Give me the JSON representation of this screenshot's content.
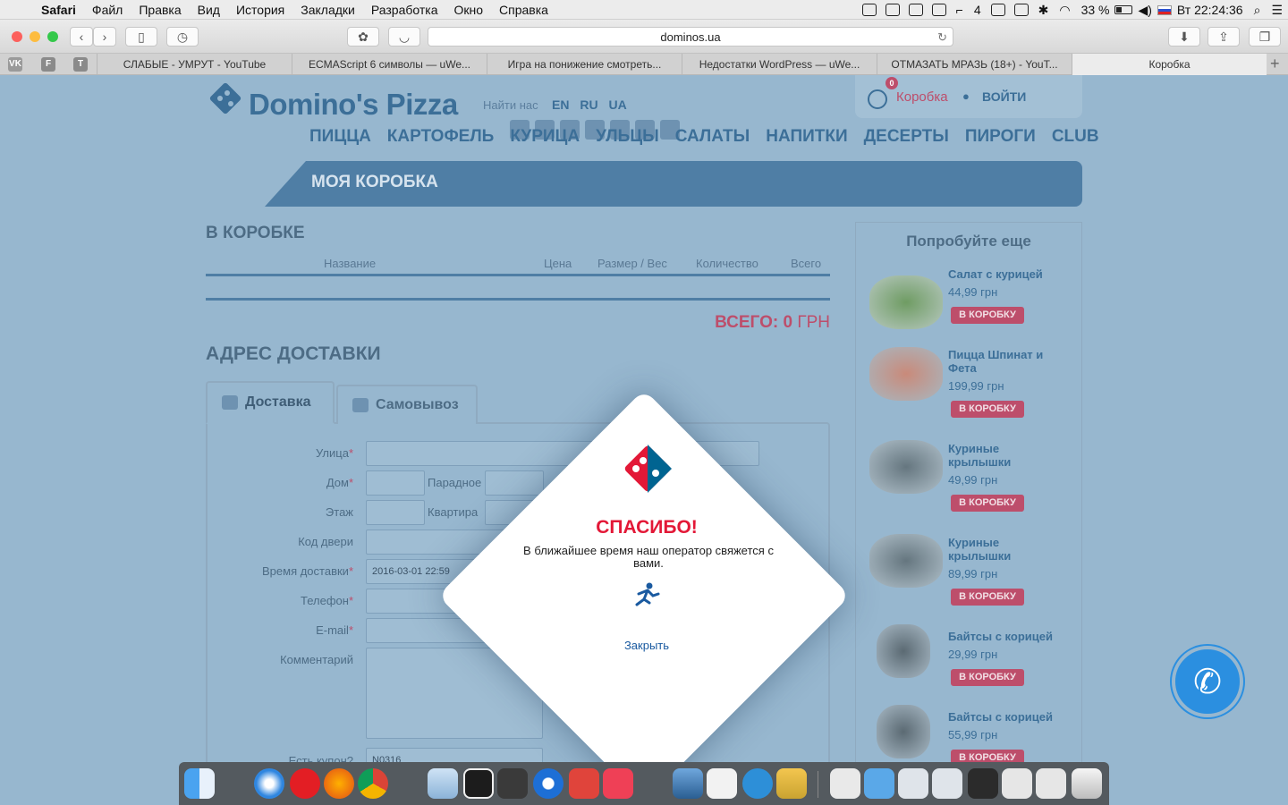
{
  "menubar": {
    "app": "Safari",
    "items": [
      "Файл",
      "Правка",
      "Вид",
      "История",
      "Закладки",
      "Разработка",
      "Окно",
      "Справка"
    ],
    "status_num": "4",
    "battery": "33 %",
    "clock": "Вт 22:24:36"
  },
  "browser": {
    "url": "dominos.ua",
    "pinned": [
      "VK",
      "F",
      "T"
    ],
    "tabs": [
      {
        "title": "СЛАБЫЕ - УМРУТ - YouTube"
      },
      {
        "title": "ECMAScript 6 символы — uWe..."
      },
      {
        "title": "Игра на понижение смотреть..."
      },
      {
        "title": "Недостатки WordPress — uWe..."
      },
      {
        "title": "ОТМАЗАТЬ МРАЗЬ (18+) - YouT..."
      },
      {
        "title": "Коробка"
      }
    ]
  },
  "header": {
    "logo": "Domino's Pizza",
    "find_us": "Найти нас",
    "langs": [
      "EN",
      "RU",
      "UA"
    ],
    "cart_count": "0",
    "cart_label": "Коробка",
    "login": "ВОЙТИ",
    "nav": [
      "ПИЦЦА",
      "КАРТОФЕЛЬ",
      "КУРИЦА",
      "УЛЬЦЫ",
      "САЛАТЫ",
      "НАПИТКИ",
      "ДЕСЕРТЫ",
      "ПИРОГИ",
      "CLUB"
    ]
  },
  "banner": {
    "title": "МОЯ КОРОБКА"
  },
  "cart": {
    "heading": "В КОРОБКЕ",
    "columns": [
      "Название",
      "Цена",
      "Размер / Вес",
      "Количество",
      "Всего"
    ],
    "total_label": "ВСЕГО: 0",
    "total_currency": "ГРН"
  },
  "address": {
    "heading": "АДРЕС ДОСТАВКИ",
    "tabs": [
      "Доставка",
      "Самовывоз"
    ],
    "fields": {
      "street": "Улица",
      "house": "Дом",
      "entrance": "Парадное",
      "floor": "Этаж",
      "apartment": "Квартира",
      "door_code": "Код двери",
      "time": "Время доставки",
      "time_value": "2016-03-01 22:59",
      "phone": "Телефон",
      "email": "E-mail",
      "comment": "Комментарий",
      "coupon": "Есть купон?",
      "coupon_value": "N0316"
    },
    "required_mark": "*"
  },
  "suggest": {
    "heading": "Попробуйте еще",
    "button": "В КОРОБКУ",
    "items": [
      {
        "name": "Салат с курицей",
        "price": "44,99 грн"
      },
      {
        "name": "Пицца Шпинат и Фета",
        "price": "199,99 грн"
      },
      {
        "name": "Куриные крылышки",
        "price": "49,99 грн"
      },
      {
        "name": "Куриные крылышки",
        "price": "89,99 грн"
      },
      {
        "name": "Байтсы с корицей",
        "price": "29,99 грн"
      },
      {
        "name": "Байтсы с корицей",
        "price": "55,99 грн"
      }
    ]
  },
  "modal": {
    "title": "СПАСИБО!",
    "text": "В ближайшее время наш оператор свяжется с вами.",
    "close": "Закрыть"
  },
  "colors": {
    "brand": "#3c6f98",
    "accent": "#bd4e6b",
    "dominos_red": "#e31837",
    "phone": "#2b8fe0"
  }
}
